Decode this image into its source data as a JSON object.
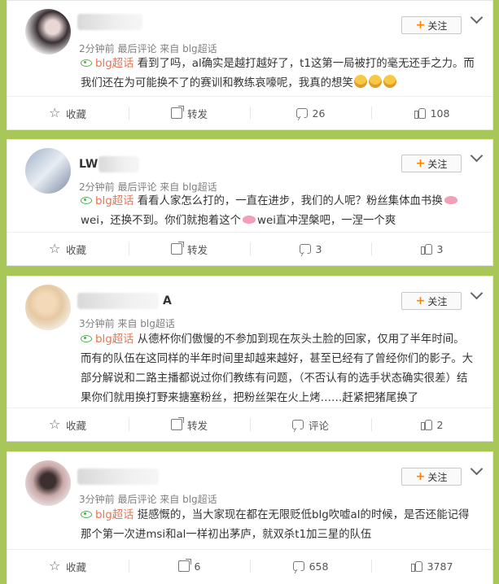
{
  "colors": {
    "background": "#a9c659",
    "topic": "#eb7350",
    "follow_plus": "#ff8200",
    "topic_icon": "#4fb04a"
  },
  "posts": [
    {
      "name_suffix": "",
      "meta": "2分钟前  最后评论  来自 blg超话",
      "follow": "关注",
      "topic": "blg超话",
      "text_parts": [
        "看到了吗，al确实是越打越好了，t1这第一局被打的毫无还手之力。而我们还在为可能换不了的赛训和教练哀嚎呢，我真的想笑"
      ],
      "emoji_count": 3,
      "actions": {
        "collect": "收藏",
        "repost": "转发",
        "comments": "26",
        "likes": "108"
      }
    },
    {
      "name_suffix": "LW",
      "meta": "2分钟前  最后评论  来自 blg超话",
      "follow": "关注",
      "topic": "blg超话",
      "text_parts": [
        "看看人家怎么打的，一直在进步，我们的人呢？粉丝集体血书换",
        "wei，还换不到。你们就抱着这个",
        "wei直冲涅槃吧，一涅一个爽"
      ],
      "actions": {
        "collect": "收藏",
        "repost": "转发",
        "comments": "3",
        "likes": "3"
      }
    },
    {
      "name_suffix": "A",
      "meta": "3分钟前  来自 blg超话",
      "follow": "关注",
      "topic": "blg超话",
      "text_parts": [
        "从德杯你们傲慢的不参加到现在灰头土脸的回家，仅用了半年时间。而有的队伍在这同样的半年时间里却越来越好，甚至已经有了曾经你们的影子。大部分解说和二路主播都说过你们教练有问题，（不否认有的选手状态确实很差）结果你们就用换打野来搪塞粉丝，把粉丝架在火上烤……赶紧把猪尾换了"
      ],
      "actions": {
        "collect": "收藏",
        "repost": "转发",
        "comment_label": "评论",
        "likes": "2"
      }
    },
    {
      "name_suffix": "",
      "meta": "3分钟前  最后评论  来自 blg超话",
      "follow": "关注",
      "topic": "blg超话",
      "text_parts": [
        "挺感慨的，当大家现在都在无限贬低blg吹嘘al的时候，是否还能记得那个第一次进msi和al一样初出茅庐，就双杀t1加三星的队伍"
      ],
      "actions": {
        "collect": "收藏",
        "repost": "6",
        "comments": "658",
        "likes": "3787"
      }
    }
  ]
}
